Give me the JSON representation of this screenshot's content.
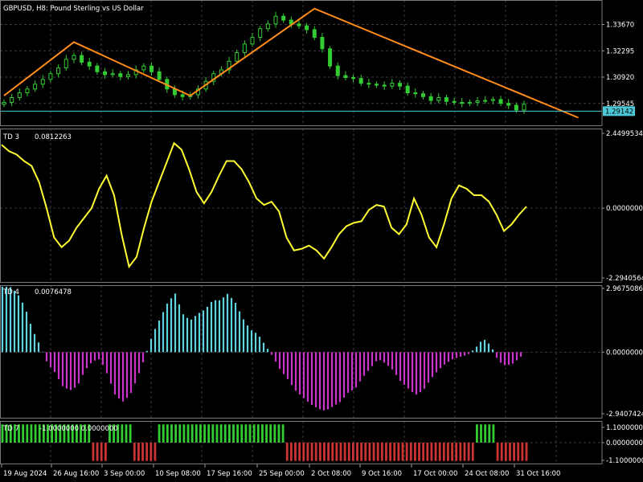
{
  "chart_data": {
    "type": "candlestick+indicators",
    "symbol": "GBPUSD",
    "timeframe": "H8",
    "description": "Pound Sterling vs US Dollar",
    "title": "GBPUSD, H8:  Pound Sterling vs US Dollar",
    "x_tick_labels": [
      "19 Aug 2024",
      "26 Aug 16:00",
      "3 Sep 00:00",
      "10 Sep 08:00",
      "17 Sep 16:00",
      "25 Sep 00:00",
      "2 Oct 08:00",
      "9 Oct 16:00",
      "17 Oct 00:00",
      "24 Oct 08:00",
      "31 Oct 16:00"
    ],
    "colors": {
      "background": "#000000",
      "grid": "#3a3a3a",
      "candles": "#33cc33",
      "zigzag": "#ff8c1a",
      "current_price_line": "#4dc8d8",
      "td3_line": "#ffff33",
      "td4_positive": "#5fd3e0",
      "td4_negative": "#cc33cc",
      "td7_up": "#33cc33",
      "td7_down": "#cc3333"
    },
    "price_panel": {
      "y_ticks": [
        1.3367,
        1.32295,
        1.3092,
        1.29545
      ],
      "y_tick_labels": [
        "1.33670",
        "1.32295",
        "1.30920",
        "1.29545"
      ],
      "current_price": 1.29142,
      "current_price_label": "1.29142",
      "closes": [
        1.296,
        1.2985,
        1.301,
        1.303,
        1.3055,
        1.308,
        1.311,
        1.314,
        1.3185,
        1.3205,
        1.317,
        1.315,
        1.312,
        1.3105,
        1.311,
        1.3095,
        1.3105,
        1.313,
        1.315,
        1.312,
        1.308,
        1.303,
        1.3,
        1.299,
        1.3,
        1.303,
        1.307,
        1.311,
        1.313,
        1.3175,
        1.322,
        1.3265,
        1.33,
        1.3345,
        1.337,
        1.341,
        1.339,
        1.337,
        1.336,
        1.334,
        1.33,
        1.324,
        1.315,
        1.31,
        1.309,
        1.3085,
        1.306,
        1.3055,
        1.305,
        1.3045,
        1.306,
        1.3045,
        1.301,
        1.3005,
        1.299,
        1.297,
        1.2985,
        1.2965,
        1.296,
        1.2955,
        1.296,
        1.2968,
        1.297,
        1.2975,
        1.2955,
        1.2945,
        1.292,
        1.295
      ],
      "zigzag": [
        [
          0,
          1.2995
        ],
        [
          9,
          1.3275
        ],
        [
          24,
          1.2995
        ],
        [
          40,
          1.345
        ],
        [
          74,
          1.288
        ]
      ]
    },
    "td3": {
      "label": "TD 3",
      "value_label": "0.0812263",
      "y_tick_labels": [
        "2.4499534",
        "0.0000000",
        "-2.2940564"
      ],
      "ylim": [
        -2.2940564,
        2.4499534
      ],
      "values": [
        1.95,
        1.75,
        1.65,
        1.45,
        1.3,
        0.8,
        0.0,
        -0.9,
        -1.2,
        -1.0,
        -0.6,
        -0.3,
        0.0,
        0.6,
        1.0,
        0.4,
        -0.8,
        -1.8,
        -1.5,
        -0.6,
        0.2,
        0.8,
        1.4,
        2.0,
        1.8,
        1.2,
        0.5,
        0.15,
        0.5,
        1.0,
        1.45,
        1.45,
        1.2,
        0.8,
        0.3,
        0.1,
        0.2,
        -0.1,
        -0.9,
        -1.3,
        -1.25,
        -1.15,
        -1.3,
        -1.55,
        -1.2,
        -0.8,
        -0.55,
        -0.45,
        -0.4,
        -0.05,
        0.1,
        0.05,
        -0.6,
        -0.8,
        -0.5,
        0.3,
        -0.2,
        -0.9,
        -1.2,
        -0.5,
        0.3,
        0.7,
        0.6,
        0.4,
        0.4,
        0.2,
        -0.2,
        -0.7,
        -0.5,
        -0.2,
        0.05
      ],
      "line_color": "#ffff33"
    },
    "td4": {
      "label": "TD 4",
      "value_label": "0.0076478",
      "y_tick_labels": [
        "2.9675086",
        "0.0000000",
        "-2.9407424"
      ],
      "ylim": [
        -2.9407424,
        2.9675086
      ],
      "values": [
        2.9,
        2.9,
        2.6,
        2.0,
        1.0,
        0.3,
        -0.5,
        -0.9,
        -1.5,
        -1.7,
        -1.5,
        -0.8,
        -0.4,
        -0.3,
        -1.0,
        -1.9,
        -2.2,
        -1.9,
        -1.1,
        -0.2,
        0.8,
        1.5,
        2.2,
        2.6,
        1.7,
        1.4,
        1.7,
        1.9,
        2.3,
        2.3,
        2.6,
        2.2,
        1.5,
        1.0,
        0.8,
        0.3,
        -0.2,
        -0.8,
        -1.2,
        -1.7,
        -2.0,
        -2.3,
        -2.5,
        -2.6,
        -2.4,
        -2.2,
        -1.8,
        -1.6,
        -1.1,
        -0.7,
        -0.3,
        -0.5,
        -0.8,
        -1.3,
        -1.6,
        -1.9,
        -1.7,
        -1.2,
        -0.8,
        -0.5,
        -0.3,
        -0.2,
        -0.1,
        0.2,
        0.6,
        0.3,
        -0.4,
        -0.6,
        -0.5,
        -0.2
      ]
    },
    "td7": {
      "label": "TD 7",
      "value_label": "-1.0000000  0.0000000",
      "y_tick_labels": [
        "1.1000000",
        "0.0000000",
        "-1.1000000"
      ],
      "ylim": [
        -1.1,
        1.1
      ],
      "segments": [
        [
          0,
          22,
          1
        ],
        [
          22,
          26,
          -1
        ],
        [
          26,
          32,
          1
        ],
        [
          32,
          38,
          -1
        ],
        [
          38,
          69,
          1
        ],
        [
          69,
          107,
          -1
        ],
        [
          107,
          115,
          -1
        ],
        [
          115,
          120,
          1
        ],
        [
          120,
          128,
          -1
        ]
      ],
      "bar_count": 128
    }
  }
}
